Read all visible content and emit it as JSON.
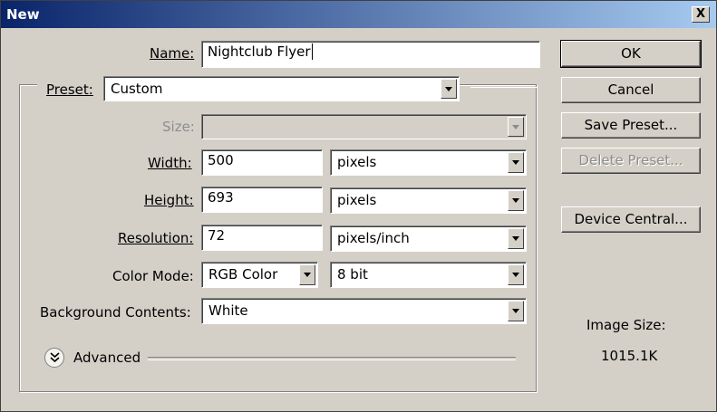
{
  "window": {
    "title": "New",
    "close_label": "X"
  },
  "name": {
    "label": "Name:",
    "value": "Nightclub Flyer"
  },
  "preset": {
    "label": "Preset:",
    "value": "Custom"
  },
  "size": {
    "label": "Size:",
    "value": ""
  },
  "width": {
    "label": "Width:",
    "value": "500",
    "unit": "pixels"
  },
  "height": {
    "label": "Height:",
    "value": "693",
    "unit": "pixels"
  },
  "resolution": {
    "label": "Resolution:",
    "value": "72",
    "unit": "pixels/inch"
  },
  "color_mode": {
    "label": "Color Mode:",
    "value": "RGB Color",
    "bits": "8 bit"
  },
  "background": {
    "label": "Background Contents:",
    "value": "White"
  },
  "advanced": {
    "label": "Advanced"
  },
  "buttons": {
    "ok": "OK",
    "cancel": "Cancel",
    "save_preset": "Save Preset...",
    "delete_preset": "Delete Preset...",
    "device_central": "Device Central..."
  },
  "image_size": {
    "label": "Image Size:",
    "value": "1015.1K"
  },
  "icons": {
    "close": "close-icon",
    "dropdown": "chevron-down-icon",
    "expander": "double-chevron-down-icon"
  }
}
